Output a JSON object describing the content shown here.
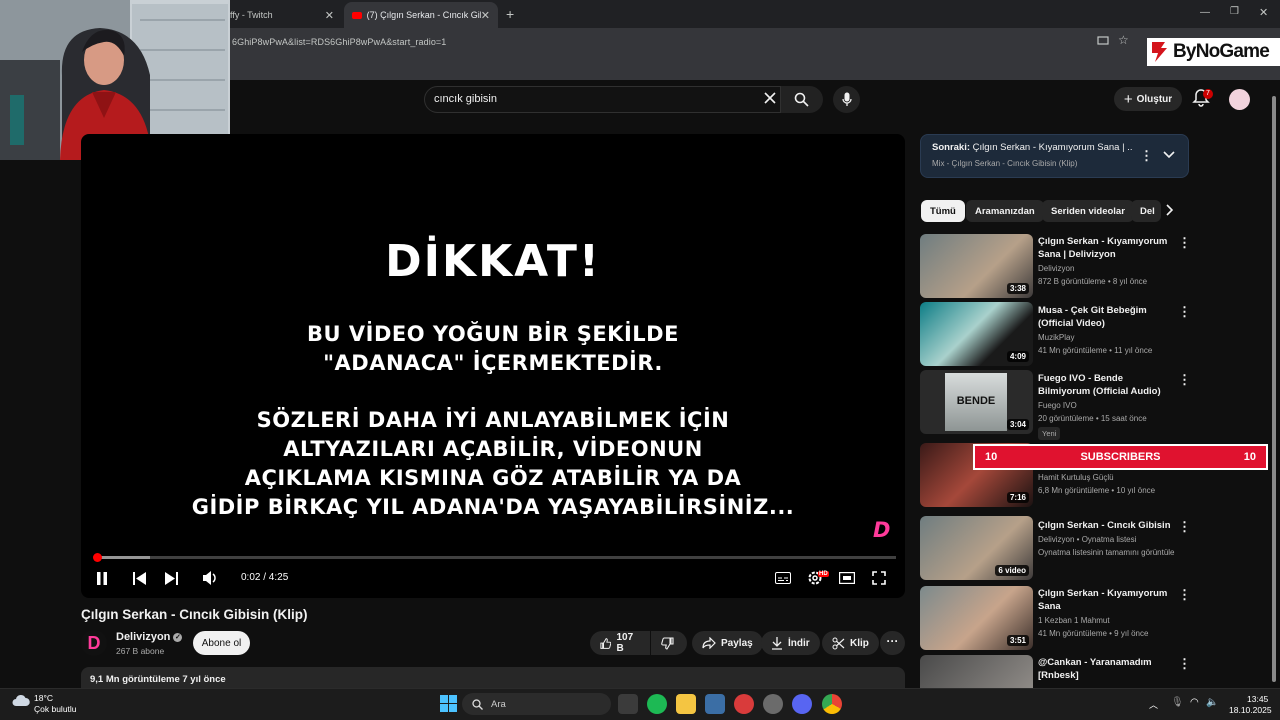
{
  "browser": {
    "tabs": [
      {
        "label": "ffy - Twitch",
        "active": false
      },
      {
        "label": "(7) Çılgın Serkan - Cıncık Gibisin",
        "active": true
      }
    ],
    "url": "6GhiP8wPwA&list=RDS6GhiP8wPwA&start_radio=1"
  },
  "watermark": {
    "brand": "ByNoGame"
  },
  "youtube": {
    "search_value": "cıncık gibisin",
    "create_label": "Oluştur",
    "notification_count": "7"
  },
  "player": {
    "heading": "DİKKAT!",
    "lines": [
      "BU VİDEO YOĞUN BİR ŞEKİLDE",
      "\"ADANACA\" İÇERMEKTEDİR.",
      "SÖZLERİ DAHA İYİ ANLAYABİLMEK İÇİN",
      "ALTYAZILARI AÇABİLİR, VİDEONUN",
      "AÇIKLAMA KISMINA GÖZ ATABİLİR YA DA",
      "GİDİP BİRKAÇ YIL ADANA'DA YAŞAYABİLİRSİNİZ..."
    ],
    "time": "0:02 / 4:25",
    "progress_fraction": 0.008,
    "quality_badge": "HD"
  },
  "video": {
    "title": "Çılgın Serkan - Cıncık Gibisin (Klip)",
    "channel": "Delivizyon",
    "subscribers": "267 B abone",
    "subscribe_label": "Abone ol",
    "likes": "107 B",
    "share_label": "Paylaş",
    "download_label": "İndir",
    "clip_label": "Klip",
    "stats": "9,1 Mn görüntüleme  7 yıl önce"
  },
  "sidebar": {
    "next_prefix": "Sonraki:",
    "next_title": "Çılgın Serkan - Kıyamıyorum Sana | ...",
    "next_sub": "Mix - Çılgın Serkan - Cıncık Gibisin (Klip)",
    "chips": [
      "Tümü",
      "Aramanızdan",
      "Seriden videolar",
      "Del"
    ],
    "items": [
      {
        "title": "Çılgın Serkan - Kıyamıyorum Sana | Delivizyon",
        "channel": "Delivizyon",
        "meta": "872 B görüntüleme • 8 yıl önce",
        "duration": "3:38"
      },
      {
        "title": "Musa - Çek Git Bebeğim (Official Video)",
        "channel": "MuzikPlay",
        "meta": "41 Mn görüntüleme • 11 yıl önce",
        "duration": "4:09"
      },
      {
        "title": "Fuego IVO - Bende Bilmiyorum (Official Audio)",
        "channel": "Fuego IVO",
        "meta": "20 görüntüleme • 15 saat önce",
        "duration": "3:04",
        "badge": "Yeni",
        "thumb_text": "BENDE"
      },
      {
        "title": "",
        "channel": "Hamit Kurtuluş Güçlü",
        "meta": "6,8 Mn görüntüleme • 10 yıl önce",
        "duration": "7:16"
      },
      {
        "title": "Çılgın Serkan - Cıncık Gibisin",
        "channel": "Delivizyon • Oynatma listesi",
        "meta": "Oynatma listesinin tamamını görüntüle",
        "duration": "6 video"
      },
      {
        "title": "Çılgın Serkan - Kıyamıyorum Sana",
        "channel": "1 Kezban 1 Mahmut",
        "meta": "41 Mn görüntüleme • 9 yıl önce",
        "duration": "3:51"
      },
      {
        "title": "@Cankan - Yaranamadım [Rnbesk]",
        "channel": "",
        "meta": "",
        "duration": ""
      }
    ]
  },
  "overlay": {
    "left_count": "10",
    "label": "SUBSCRIBERS",
    "right_count": "10"
  },
  "taskbar": {
    "temperature": "18°C",
    "weather": "Çok bulutlu",
    "search_placeholder": "Ara",
    "time": "13:45",
    "date": "18.10.2025"
  },
  "colors": {
    "accent": "#ff0000",
    "overlay": "#e0122f"
  }
}
